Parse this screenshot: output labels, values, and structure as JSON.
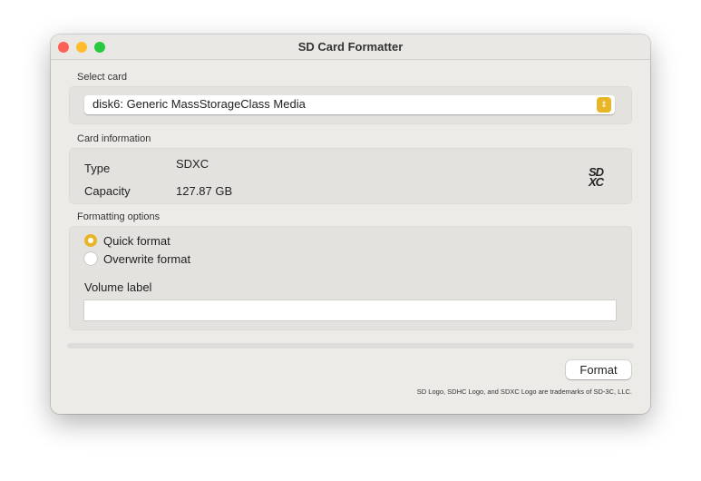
{
  "window": {
    "title": "SD Card Formatter"
  },
  "select_card": {
    "label": "Select card",
    "selected": "disk6: Generic MassStorageClass Media"
  },
  "card_info": {
    "label": "Card information",
    "type_label": "Type",
    "type_value": "SDXC",
    "capacity_label": "Capacity",
    "capacity_value": "127.87 GB",
    "logo_text": "SDXC"
  },
  "formatting": {
    "label": "Formatting options",
    "options": [
      {
        "label": "Quick format",
        "selected": true
      },
      {
        "label": "Overwrite format",
        "selected": false
      }
    ],
    "volume_label": "Volume label",
    "volume_value": ""
  },
  "progress": 0,
  "format_button": "Format",
  "footer": "SD Logo, SDHC Logo, and SDXC Logo are trademarks of SD-3C, LLC.",
  "colors": {
    "accent": "#e8b526"
  }
}
